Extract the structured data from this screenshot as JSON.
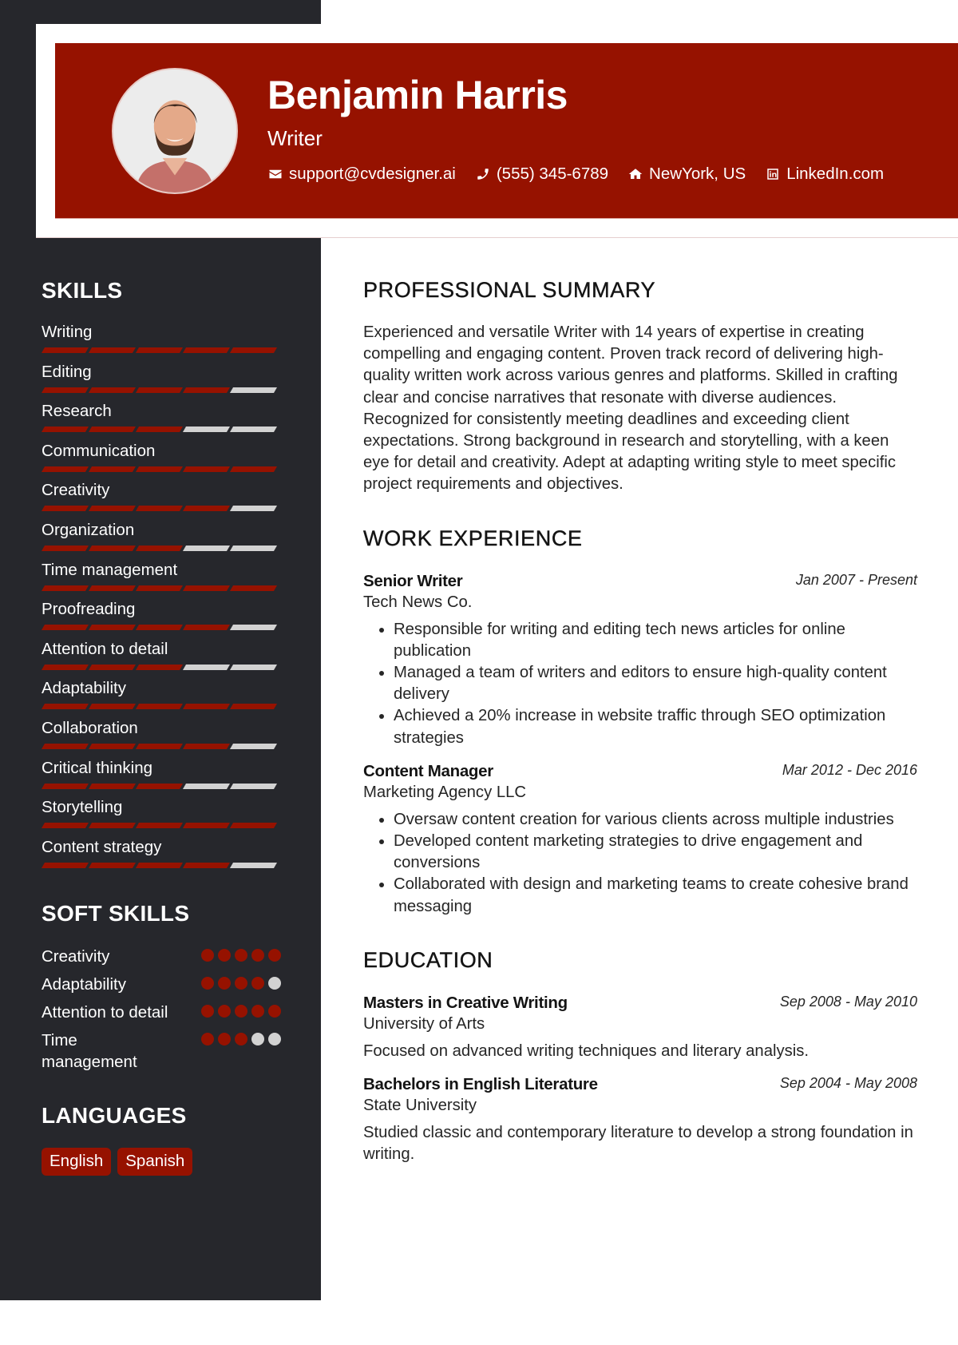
{
  "header": {
    "name": "Benjamin Harris",
    "title": "Writer",
    "contacts": [
      {
        "icon": "envelope-icon",
        "text": "support@cvdesigner.ai"
      },
      {
        "icon": "phone-icon",
        "text": "(555) 345-6789"
      },
      {
        "icon": "home-icon",
        "text": "NewYork, US"
      },
      {
        "icon": "linkedin-icon",
        "text": "LinkedIn.com"
      }
    ]
  },
  "colors": {
    "accent": "#961200",
    "sidebar_bg": "#26272c",
    "inactive": "#d2d2d2"
  },
  "sidebar": {
    "skills_heading": "SKILLS",
    "skills_max": 5,
    "skills": [
      {
        "label": "Writing",
        "level": 5
      },
      {
        "label": "Editing",
        "level": 4
      },
      {
        "label": "Research",
        "level": 3
      },
      {
        "label": "Communication",
        "level": 5
      },
      {
        "label": "Creativity",
        "level": 4
      },
      {
        "label": "Organization",
        "level": 3
      },
      {
        "label": "Time management",
        "level": 5
      },
      {
        "label": "Proofreading",
        "level": 4
      },
      {
        "label": "Attention to detail",
        "level": 3
      },
      {
        "label": "Adaptability",
        "level": 5
      },
      {
        "label": "Collaboration",
        "level": 4
      },
      {
        "label": "Critical thinking",
        "level": 3
      },
      {
        "label": "Storytelling",
        "level": 5
      },
      {
        "label": "Content strategy",
        "level": 4
      }
    ],
    "soft_skills_heading": "SOFT SKILLS",
    "soft_skills_max": 5,
    "soft_skills": [
      {
        "label": "Creativity",
        "level": 5
      },
      {
        "label": "Adaptability",
        "level": 4
      },
      {
        "label": "Attention to detail",
        "level": 5
      },
      {
        "label": "Time management",
        "level": 3
      }
    ],
    "languages_heading": "LANGUAGES",
    "languages": [
      "English",
      "Spanish"
    ]
  },
  "main": {
    "summary_heading": "PROFESSIONAL SUMMARY",
    "summary": "Experienced and versatile Writer with 14 years of expertise in creating compelling and engaging content. Proven track record of delivering high-quality written work across various genres and platforms. Skilled in crafting clear and concise narratives that resonate with diverse audiences. Recognized for consistently meeting deadlines and exceeding client expectations. Strong background in research and storytelling, with a keen eye for detail and creativity. Adept at adapting writing style to meet specific project requirements and objectives.",
    "experience_heading": "WORK EXPERIENCE",
    "experience": [
      {
        "title": "Senior Writer",
        "dates": "Jan 2007 - Present",
        "company": "Tech News Co.",
        "bullets": [
          "Responsible for writing and editing tech news articles for online publication",
          "Managed a team of writers and editors to ensure high-quality content delivery",
          "Achieved a 20% increase in website traffic through SEO optimization strategies"
        ]
      },
      {
        "title": "Content Manager",
        "dates": "Mar 2012 - Dec 2016",
        "company": "Marketing Agency LLC",
        "bullets": [
          "Oversaw content creation for various clients across multiple industries",
          "Developed content marketing strategies to drive engagement and conversions",
          "Collaborated with design and marketing teams to create cohesive brand messaging"
        ]
      }
    ],
    "education_heading": "EDUCATION",
    "education": [
      {
        "degree": "Masters in Creative Writing",
        "dates": "Sep 2008 - May 2010",
        "school": "University of Arts",
        "description": "Focused on advanced writing techniques and literary analysis."
      },
      {
        "degree": "Bachelors in English Literature",
        "dates": "Sep 2004 - May 2008",
        "school": "State University",
        "description": "Studied classic and contemporary literature to develop a strong foundation in writing."
      }
    ]
  }
}
